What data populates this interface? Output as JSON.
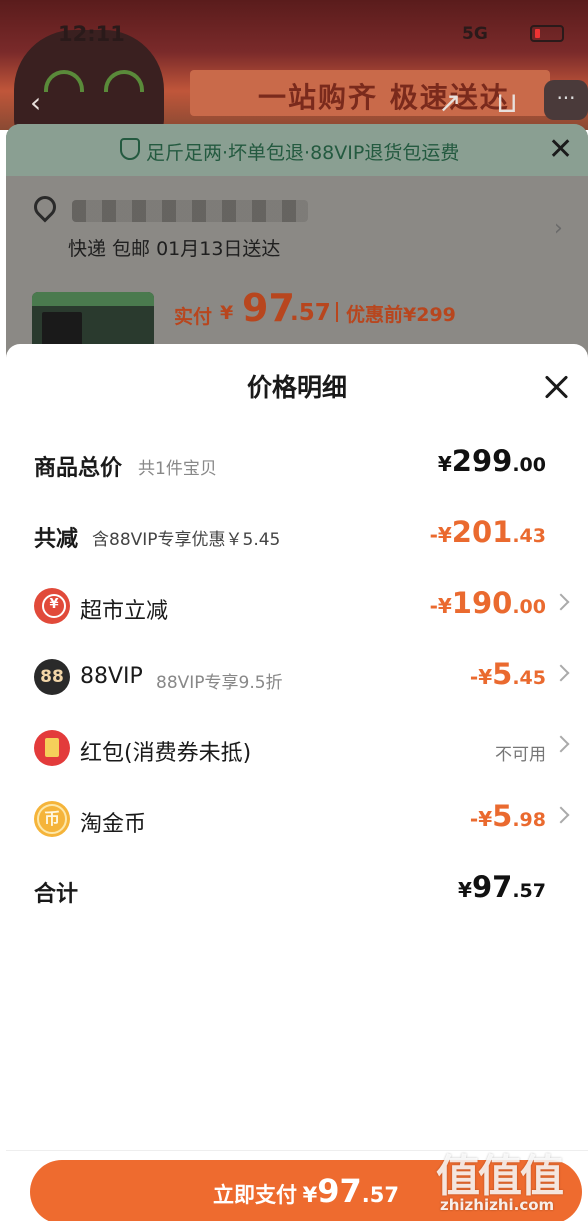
{
  "status_bar": {
    "time": "12:11",
    "network": "5G"
  },
  "background_page": {
    "banner_text": "一站购齐 极速送达",
    "guarantee": "足斤足两·坏单包退·88VIP退货包运费",
    "delivery": "快递 包邮 01月13日送达",
    "paid_label": "实付",
    "paid_yen": "¥",
    "paid_int": "97",
    "paid_dec": ".57",
    "before_discount": "优惠前¥299"
  },
  "price_detail": {
    "title": "价格明细",
    "rows": [
      {
        "label": "商品总价",
        "sub": "共1件宝贝",
        "yen": "¥",
        "int": "299",
        "dec": ".00"
      },
      {
        "label": "共减",
        "sub": "含88VIP专享优惠￥5.45",
        "yen": "-¥",
        "int": "201",
        "dec": ".43"
      },
      {
        "label": "超市立减",
        "yen": "-¥",
        "int": "190",
        "dec": ".00"
      },
      {
        "label": "88VIP",
        "icon_text": "88",
        "sub": "88VIP专享9.5折",
        "yen": "-¥",
        "int": "5",
        "dec": ".45"
      },
      {
        "label": "红包(消费券未抵)",
        "status": "不可用"
      },
      {
        "label": "淘金币",
        "icon_text": "币",
        "yen": "-¥",
        "int": "5",
        "dec": ".98"
      },
      {
        "label": "合计",
        "yen": "¥",
        "int": "97",
        "dec": ".57"
      }
    ],
    "pay_button": {
      "label": "立即支付",
      "yen": "¥",
      "int": "97",
      "dec": ".57"
    }
  },
  "watermark": {
    "glyphs": "值值值",
    "url": "zhizhizhi.com"
  },
  "colors": {
    "accent": "#ee6b2f",
    "discount": "#ea6a2f",
    "text": "#1a1a1a",
    "muted": "#888888"
  }
}
